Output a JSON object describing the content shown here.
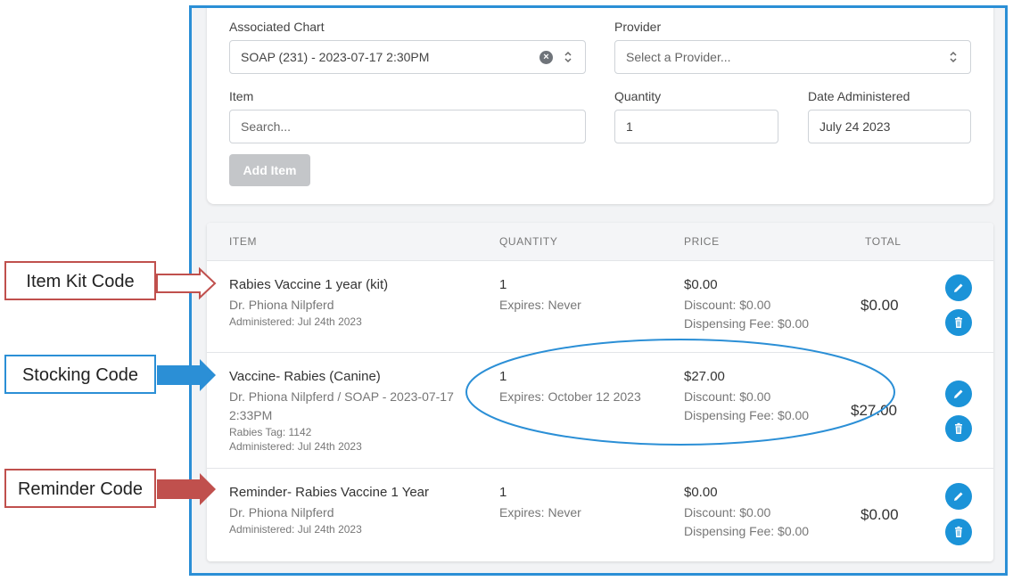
{
  "form": {
    "associated_chart_label": "Associated Chart",
    "associated_chart_value": "SOAP (231) - 2023-07-17 2:30PM",
    "provider_label": "Provider",
    "provider_placeholder": "Select a Provider...",
    "item_label": "Item",
    "item_placeholder": "Search...",
    "quantity_label": "Quantity",
    "quantity_value": "1",
    "date_label": "Date Administered",
    "date_value": "July 24 2023",
    "add_item_button": "Add Item"
  },
  "table": {
    "headers": [
      "ITEM",
      "QUANTITY",
      "PRICE",
      "TOTAL"
    ],
    "rows": [
      {
        "name": "Rabies Vaccine 1 year (kit)",
        "provider": "Dr. Phiona Nilpferd",
        "administered": "Administered: Jul 24th 2023",
        "quantity": "1",
        "expires": "Expires: Never",
        "price": "$0.00",
        "discount": "Discount: $0.00",
        "dispensing_fee": "Dispensing Fee: $0.00",
        "total": "$0.00"
      },
      {
        "name": "Vaccine- Rabies (Canine)",
        "provider_line1": "Dr. Phiona Nilpferd / SOAP - 2023-07-17",
        "provider_line2": "2:33PM",
        "tag": "Rabies Tag: 1142",
        "administered": "Administered: Jul 24th 2023",
        "quantity": "1",
        "expires": "Expires: October 12 2023",
        "price": "$27.00",
        "discount": "Discount: $0.00",
        "dispensing_fee": "Dispensing Fee: $0.00",
        "total": "$27.00"
      },
      {
        "name": "Reminder- Rabies Vaccine 1 Year",
        "provider": "Dr. Phiona Nilpferd",
        "administered": "Administered: Jul 24th 2023",
        "quantity": "1",
        "expires": "Expires: Never",
        "price": "$0.00",
        "discount": "Discount: $0.00",
        "dispensing_fee": "Dispensing Fee: $0.00",
        "total": "$0.00"
      }
    ]
  },
  "callouts": {
    "kit": "Item Kit Code",
    "stocking": "Stocking Code",
    "reminder": "Reminder Code"
  },
  "colors": {
    "frame_border": "#2b8fd6",
    "action_button": "#1b93d8",
    "kit_callout": "#c0504d",
    "stocking_callout": "#2b8fd6",
    "reminder_callout": "#c0504d"
  },
  "icons": [
    "clear-icon",
    "up-down-chevron-icon",
    "edit-pencil-icon",
    "trash-icon"
  ]
}
